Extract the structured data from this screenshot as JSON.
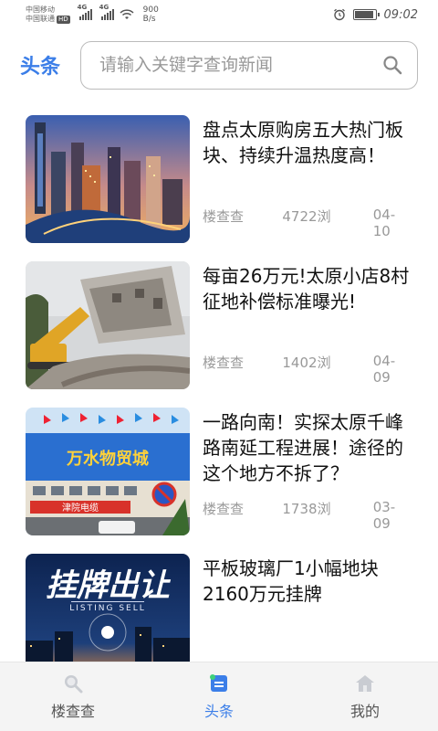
{
  "status_bar": {
    "carrier_1": "中国移动",
    "carrier_2": "中国联通",
    "hd_badge": "HD",
    "signal_1": "4G",
    "signal_2": "4G",
    "net_speed_value": "900",
    "net_speed_unit": "B/s",
    "time": "09:02",
    "battery_level": 0.85
  },
  "header": {
    "brand": "头条",
    "search_placeholder": "请输入关键字查询新闻"
  },
  "news": [
    {
      "title": "盘点太原购房五大热门板块、持续升温热度高！",
      "source": "楼查查",
      "views": "4722浏",
      "date": "04-10"
    },
    {
      "title": "每亩26万元!太原小店8村征地补偿标准曝光!",
      "source": "楼查查",
      "views": "1402浏",
      "date": "04-09"
    },
    {
      "title": "一路向南！实探太原千峰路南延工程进展！途径的这个地方不拆了？",
      "source": "楼查查",
      "views": "1738浏",
      "date": "03-09"
    },
    {
      "title": "平板玻璃厂1小幅地块2160万元挂牌",
      "source": "",
      "views": "",
      "date": "",
      "image_text_main": "挂牌出让",
      "image_text_sub": "LISTING SELL"
    }
  ],
  "thumb_texts": {
    "store_sign": "万水物贸城",
    "store_banner": "津院电缆"
  },
  "bottom_nav": [
    {
      "label": "楼查查",
      "icon": "search-icon",
      "active": false
    },
    {
      "label": "头条",
      "icon": "news-icon",
      "active": true
    },
    {
      "label": "我的",
      "icon": "home-icon",
      "active": false
    }
  ],
  "colors": {
    "accent": "#3b7ee8",
    "meta_text": "#999999",
    "nav_background": "#f4f4f4"
  }
}
